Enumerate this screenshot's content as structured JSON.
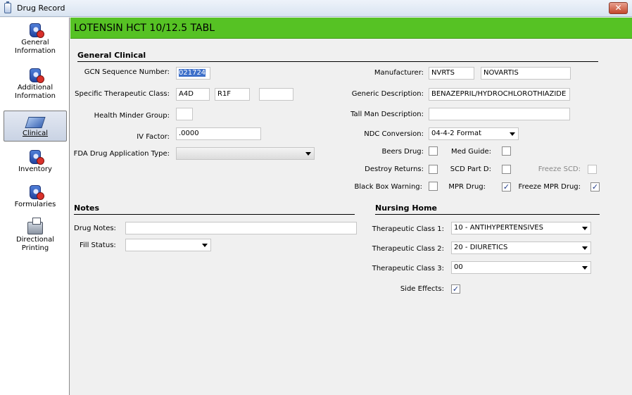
{
  "window": {
    "title": "Drug Record",
    "close_icon": "close-icon"
  },
  "sidebar": {
    "items": [
      {
        "label_line1": "General",
        "label_line2": "Information",
        "icon": "bottle-icon"
      },
      {
        "label_line1": "Additional",
        "label_line2": "Information",
        "icon": "bottle-icon"
      },
      {
        "label_line1": "Clinical",
        "label_line2": "",
        "icon": "book-icon",
        "selected": true
      },
      {
        "label_line1": "Inventory",
        "label_line2": "",
        "icon": "bottles-icon"
      },
      {
        "label_line1": "Formularies",
        "label_line2": "",
        "icon": "bottle-icon"
      },
      {
        "label_line1": "Directional",
        "label_line2": "Printing",
        "icon": "printer-icon"
      }
    ]
  },
  "banner": {
    "drug_name": "LOTENSIN HCT 10/12.5 TABL",
    "color": "#56c224"
  },
  "general_clinical": {
    "title": "General Clinical",
    "gcn_label": "GCN Sequence Number:",
    "gcn_value": "021724",
    "stc_label": "Specific Therapeutic Class:",
    "stc_values": [
      "A4D",
      "R1F",
      ""
    ],
    "health_minder_label": "Health Minder Group:",
    "health_minder_value": "",
    "iv_factor_label": "IV Factor:",
    "iv_factor_value": ".0000",
    "fda_label": "FDA Drug Application Type:",
    "fda_value": "",
    "manufacturer_label": "Manufacturer:",
    "manufacturer_code": "NVRTS",
    "manufacturer_name": "NOVARTIS",
    "generic_label": "Generic Description:",
    "generic_value": "BENAZEPRIL/HYDROCHLOROTHIAZIDE",
    "tallman_label": "Tall Man Description:",
    "tallman_value": "",
    "ndc_label": "NDC Conversion:",
    "ndc_value": "04-4-2 Format",
    "beers_label": "Beers Drug:",
    "med_guide_label": "Med Guide:",
    "destroy_label": "Destroy Returns:",
    "scd_label": "SCD Part D:",
    "freeze_scd_label": "Freeze SCD:",
    "black_box_label": "Black Box Warning:",
    "mpr_label": "MPR Drug:",
    "freeze_mpr_label": "Freeze MPR Drug:",
    "checkboxes": {
      "beers": false,
      "med_guide": false,
      "destroy": false,
      "scd": false,
      "freeze_scd": false,
      "black_box": false,
      "mpr": true,
      "freeze_mpr": true
    }
  },
  "notes": {
    "title": "Notes",
    "drug_notes_label": "Drug Notes:",
    "drug_notes_value": "",
    "fill_status_label": "Fill Status:",
    "fill_status_value": ""
  },
  "nursing_home": {
    "title": "Nursing Home",
    "tc1_label": "Therapeutic Class 1:",
    "tc1_value": "10 - ANTIHYPERTENSIVES",
    "tc2_label": "Therapeutic Class 2:",
    "tc2_value": "20 - DIURETICS",
    "tc3_label": "Therapeutic Class 3:",
    "tc3_value": "00",
    "side_effects_label": "Side Effects:",
    "side_effects_checked": true
  },
  "check_glyph": "✓",
  "close_glyph": "✕"
}
